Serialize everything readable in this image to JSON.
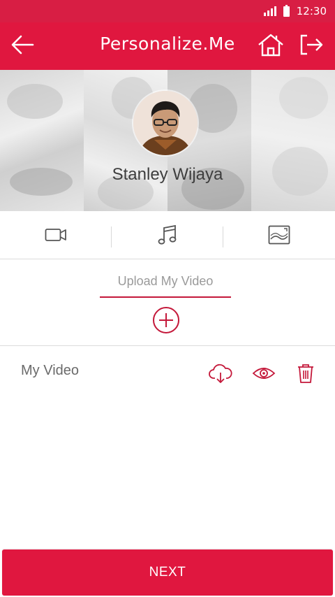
{
  "status": {
    "time": "12:30"
  },
  "header": {
    "title": "Personalize.Me",
    "back_icon": "arrow-left-icon",
    "home_icon": "home-icon",
    "logout_icon": "logout-icon"
  },
  "profile": {
    "name": "Stanley Wijaya"
  },
  "tabs": [
    {
      "icon": "video-camera-icon"
    },
    {
      "icon": "music-note-icon"
    },
    {
      "icon": "image-icon"
    }
  ],
  "upload": {
    "placeholder": "Upload My Video",
    "add_icon": "plus-circle-icon"
  },
  "video_row": {
    "label": "My Video",
    "actions": [
      "cloud-download-icon",
      "eye-icon",
      "trash-icon"
    ]
  },
  "footer": {
    "next_label": "NEXT"
  },
  "colors": {
    "primary": "#e0173f",
    "status_bar": "#d81e44",
    "accent_dark": "#c4183a"
  }
}
